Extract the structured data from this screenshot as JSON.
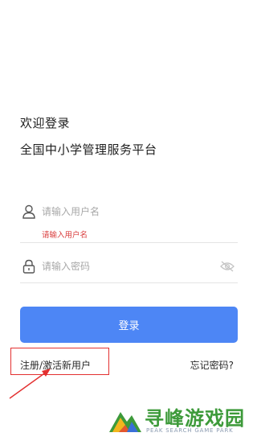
{
  "header": {
    "welcome": "欢迎登录",
    "platform_title": "全国中小学管理服务平台"
  },
  "form": {
    "username": {
      "placeholder": "请输入用户名",
      "value": "",
      "error": "请输入用户名",
      "icon": "user-icon"
    },
    "password": {
      "placeholder": "请输入密码",
      "value": "",
      "icon": "lock-icon",
      "toggle_icon": "eye-hidden-icon"
    },
    "login_label": "登录"
  },
  "links": {
    "register": "注册/激活新用户",
    "forgot_password": "忘记密码?"
  },
  "watermark": {
    "title": "寻峰游戏园",
    "subtitle": "PEAK SEARCH GAME PARK"
  },
  "colors": {
    "primary": "#4d86f5",
    "error": "#d93a3a",
    "annotation": "#e33030",
    "watermark": "#3d9a3a"
  }
}
